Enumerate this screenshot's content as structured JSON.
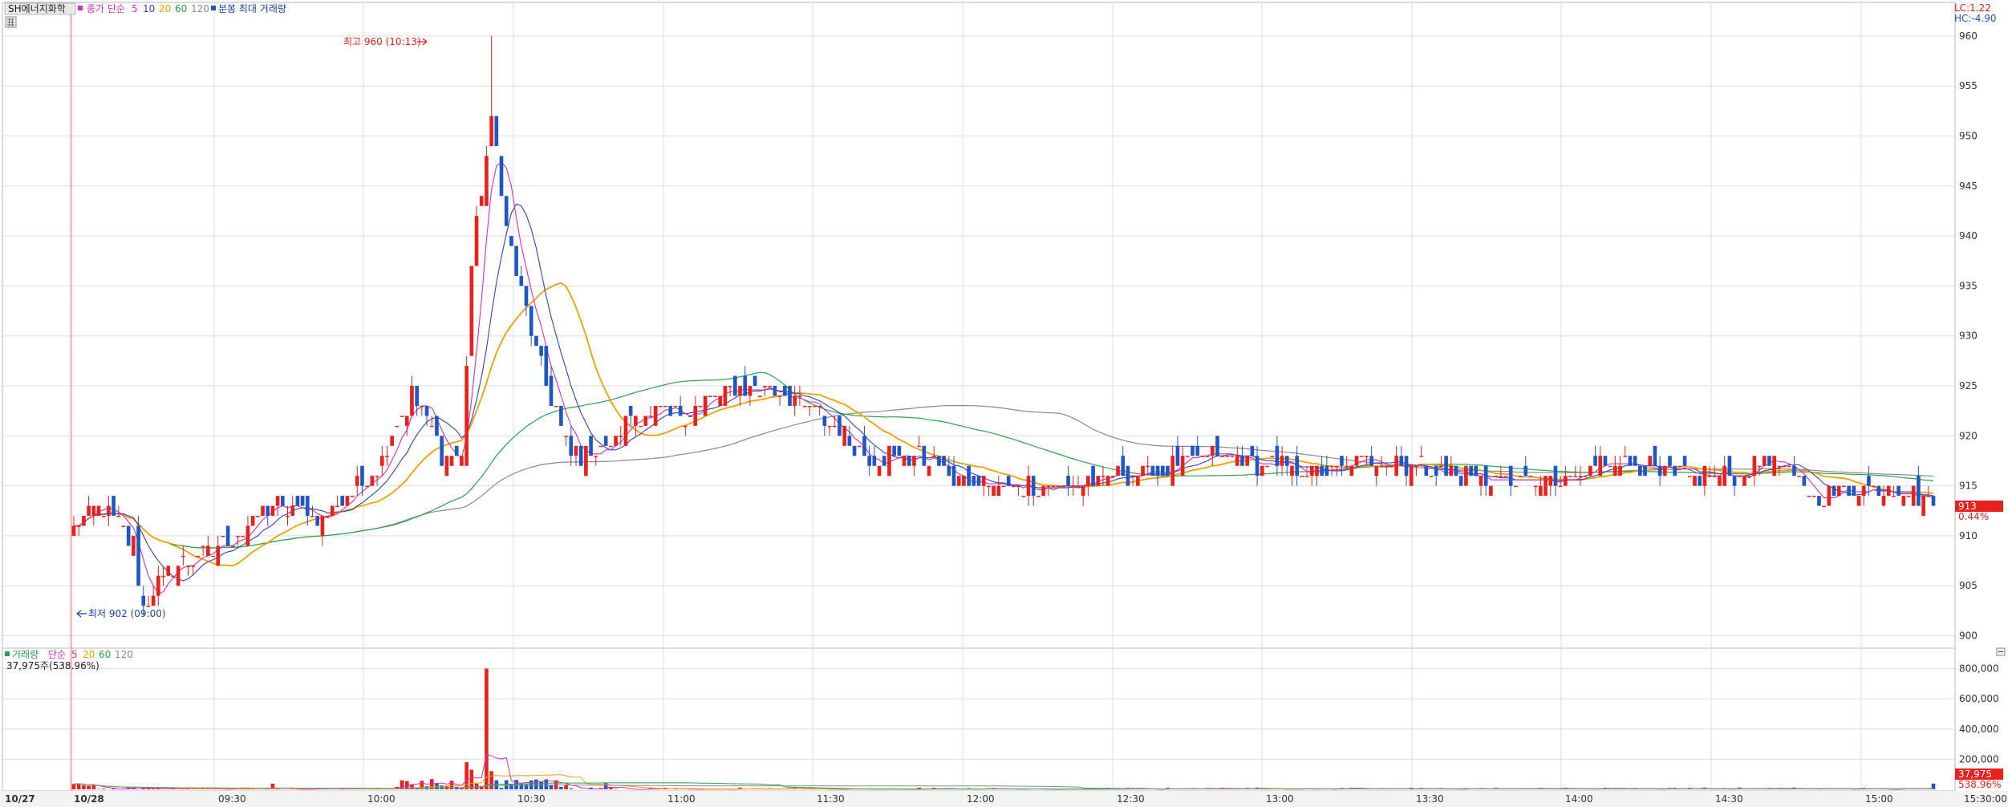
{
  "price_legend": {
    "stock_name": "SH에너지화학",
    "ma_label": "종가 단순",
    "ma_periods": [
      "5",
      "10",
      "20",
      "60",
      "120"
    ],
    "extra": "분봉 최대 거래량"
  },
  "volume_legend": {
    "label": "거래량",
    "ma_label": "단순",
    "ma_periods": [
      "5",
      "20",
      "60",
      "120"
    ],
    "current": "37,975주(538.96%)"
  },
  "corner": {
    "lc": "LC:1.22",
    "hc": "HC:-4.90"
  },
  "annotations": {
    "high": "최고 960 (10:13)",
    "low": "최저 902 (09:00)"
  },
  "price_tag": {
    "value": "913",
    "change": "0.44%"
  },
  "volume_tag": {
    "value": "37,975",
    "pct": "538.96%"
  },
  "colors": {
    "up": "#e8211c",
    "down": "#1f56c6",
    "ma5": "#d62fbd",
    "ma10": "#3044b4",
    "ma20": "#f0a000",
    "ma60": "#2aa44a",
    "ma120": "#8a8a8a",
    "grid": "#dedede",
    "accent_line": "#ff6b6b"
  },
  "chart_data": {
    "type": "candlestick",
    "price_axis": {
      "ticks": [
        900,
        905,
        910,
        915,
        920,
        925,
        930,
        935,
        940,
        945,
        950,
        955,
        960
      ],
      "ylim": [
        899,
        962
      ]
    },
    "volume_axis": {
      "ticks": [
        "200,000",
        "400,000",
        "600,000",
        "800,000"
      ],
      "tick_values": [
        200000,
        400000,
        600000,
        800000
      ],
      "ylim": [
        0,
        840000
      ]
    },
    "x_labels": [
      "10/27",
      "10/28",
      "09:30",
      "10:00",
      "10:30",
      "11:00",
      "11:30",
      "12:00",
      "12:30",
      "13:00",
      "13:30",
      "14:00",
      "14:30",
      "15:00",
      "15:30:00"
    ],
    "high": 960,
    "low": 902,
    "last": 913,
    "keypoints": [
      [
        0,
        911
      ],
      [
        6,
        913
      ],
      [
        12,
        909
      ],
      [
        14,
        903
      ],
      [
        20,
        907
      ],
      [
        30,
        909
      ],
      [
        40,
        913
      ],
      [
        50,
        912
      ],
      [
        60,
        916
      ],
      [
        68,
        924
      ],
      [
        70,
        923
      ],
      [
        74,
        918
      ],
      [
        78,
        918
      ],
      [
        80,
        937
      ],
      [
        84,
        952
      ],
      [
        87,
        941
      ],
      [
        92,
        930
      ],
      [
        100,
        918
      ],
      [
        108,
        919
      ],
      [
        112,
        922
      ],
      [
        122,
        922
      ],
      [
        130,
        924
      ],
      [
        140,
        925
      ],
      [
        150,
        922
      ],
      [
        160,
        918
      ],
      [
        170,
        918
      ],
      [
        180,
        915
      ],
      [
        200,
        915
      ],
      [
        222,
        917
      ],
      [
        230,
        918
      ],
      [
        250,
        916
      ],
      [
        262,
        918
      ],
      [
        280,
        916
      ],
      [
        300,
        915
      ],
      [
        310,
        918
      ],
      [
        320,
        916
      ],
      [
        335,
        916
      ],
      [
        340,
        918
      ],
      [
        350,
        914
      ],
      [
        365,
        915
      ],
      [
        375,
        913
      ]
    ],
    "candles": 375,
    "volume_peak": {
      "value": 800000,
      "time": "10:13"
    }
  }
}
